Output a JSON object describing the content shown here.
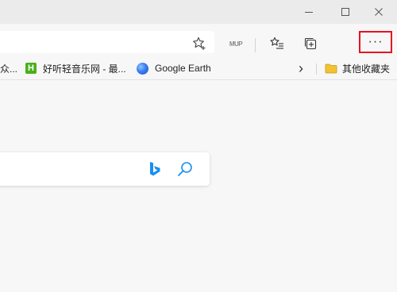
{
  "window": {
    "minimize_glyph": "—",
    "maximize_glyph": "☐",
    "close_glyph": "✕"
  },
  "toolbar": {
    "extension_label": "MUP",
    "more_glyph": "···"
  },
  "bookmarks": {
    "partial_item": "众...",
    "items": [
      {
        "label": "好听轻音乐网 - 最...",
        "icon": "h-site-icon",
        "icon_letter": "H"
      },
      {
        "label": "Google Earth",
        "icon": "earth-icon"
      }
    ],
    "overflow_glyph": "›",
    "other_folder": "其他收藏夹"
  },
  "colors": {
    "highlight_border": "#e81123",
    "bing_blue": "#1a8ef0",
    "h_icon_green": "#4caf1a",
    "folder_yellow": "#f2c233"
  }
}
